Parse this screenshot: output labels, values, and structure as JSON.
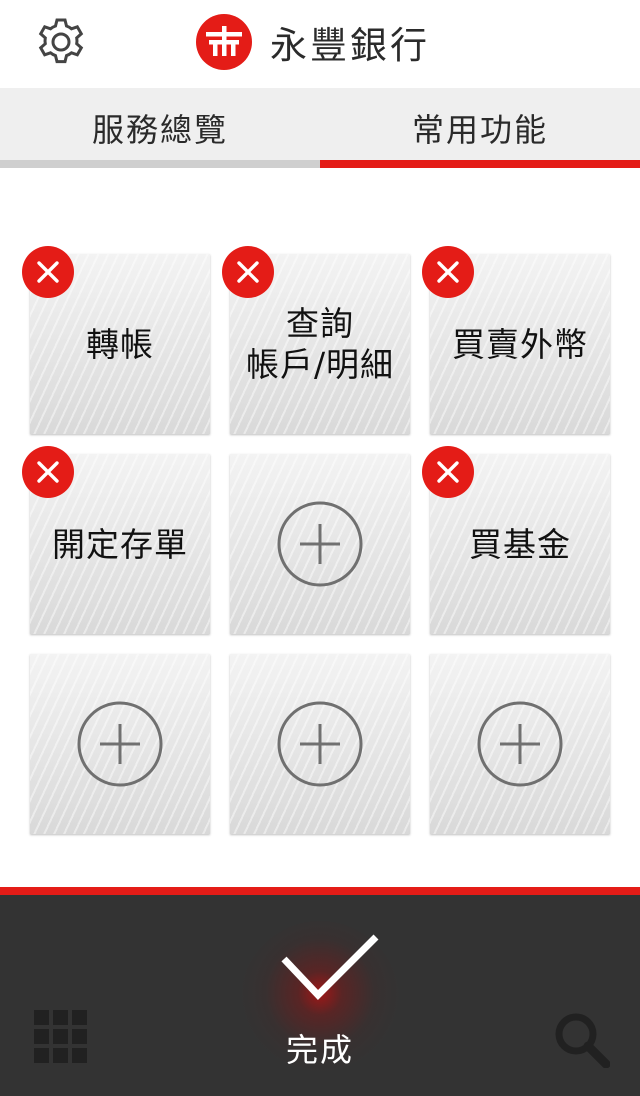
{
  "header": {
    "brand_name": "永豐銀行",
    "settings_icon": "gear-icon",
    "logo_icon": "sinopac-logo",
    "brand_color": "#e41c17"
  },
  "tabs": [
    {
      "label": "服務總覽",
      "active": false
    },
    {
      "label": "常用功能",
      "active": true
    }
  ],
  "tiles": [
    {
      "label": "轉帳",
      "removable": true
    },
    {
      "label": "查詢\n帳戶/明細",
      "removable": true
    },
    {
      "label": "買賣外幣",
      "removable": true
    },
    {
      "label": "開定存單",
      "removable": true
    },
    {
      "label": "",
      "removable": false,
      "icon": "plus-circle-icon"
    },
    {
      "label": "買基金",
      "removable": true
    },
    {
      "label": "",
      "removable": false,
      "icon": "plus-circle-icon"
    },
    {
      "label": "",
      "removable": false,
      "icon": "plus-circle-icon"
    },
    {
      "label": "",
      "removable": false,
      "icon": "plus-circle-icon"
    }
  ],
  "footer": {
    "done_label": "完成",
    "left_icon": "grid-icon",
    "right_icon": "search-icon",
    "background": "#333333"
  }
}
